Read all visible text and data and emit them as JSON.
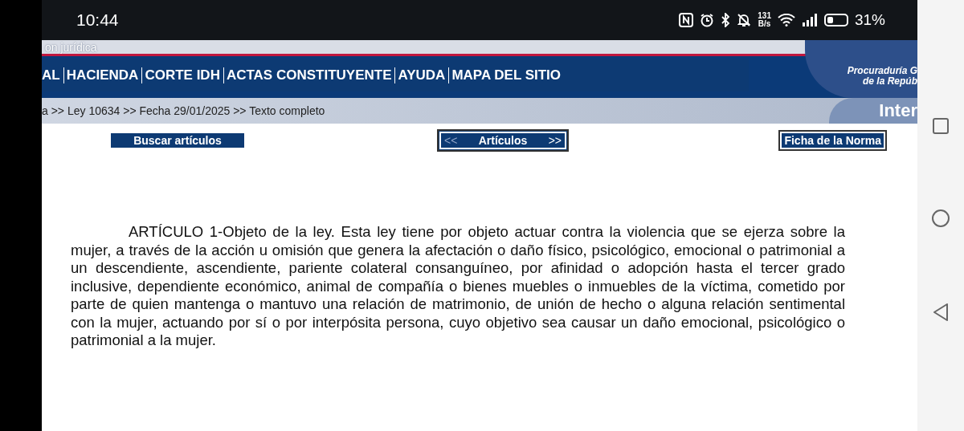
{
  "status_bar": {
    "time": "10:44",
    "network_speed": [
      "131",
      "B/s"
    ],
    "battery": "31%"
  },
  "header": {
    "site_title": "on jurídica",
    "menu": [
      {
        "label": "AL"
      },
      {
        "label": "HACIENDA"
      },
      {
        "label": "CORTE IDH"
      },
      {
        "label": "ACTAS CONSTITUYENTE"
      },
      {
        "label": "AYUDA"
      },
      {
        "label": "MAPA DEL SITIO"
      }
    ],
    "agency": [
      "Procuraduría G",
      "de la Repúb"
    ],
    "section_title": "Inter"
  },
  "breadcrumb": "a >> Ley 10634 >> Fecha 29/01/2025 >> Texto completo",
  "toolbar": {
    "search_button": "Buscar artículos",
    "previous": "<<",
    "articles": "Artículos",
    "next": ">>",
    "record_button": "Ficha de la Norma"
  },
  "article": "ARTÍCULO 1-Objeto de la ley. Esta ley tiene por objeto actuar contra la violencia que se ejerza sobre la mujer, a través de la acción u omisión que genera la afectación o daño físico, psicológico, emocional o patrimonial a un descendiente, ascendiente, pariente colateral consanguíneo, por afinidad o adopción hasta el tercer grado inclusive, dependiente económico, animal de compañía o bienes muebles o inmuebles de la víctima, cometido por parte de quien mantenga o mantuvo una relación de matrimonio, de unión de hecho o alguna relación sentimental con la mujer, actuando por sí o por interpósita persona, cuyo objetivo sea causar un daño emocional, psicológico o patrimonial a la mujer."
}
